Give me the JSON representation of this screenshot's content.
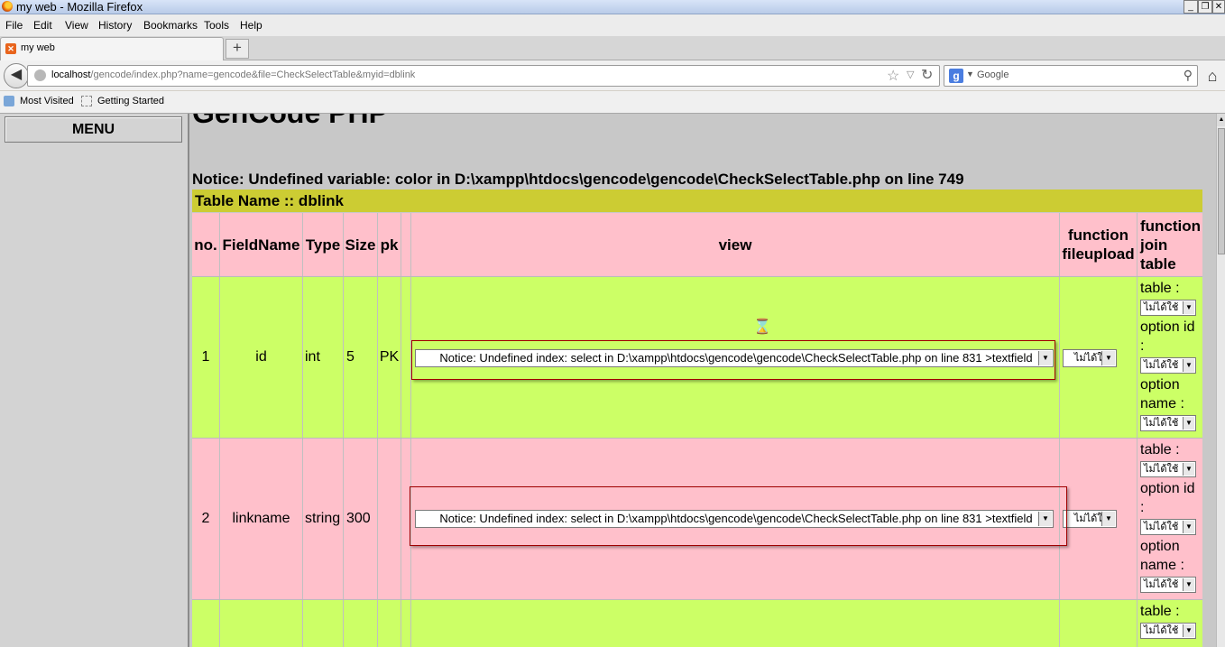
{
  "window": {
    "title": "my web - Mozilla Firefox",
    "min": "_",
    "restore": "❐",
    "close": "✕"
  },
  "menubar": [
    "File",
    "Edit",
    "View",
    "History",
    "Bookmarks",
    "Tools",
    "Help"
  ],
  "tab": {
    "label": "my web",
    "new_tab": "+"
  },
  "address": {
    "host": "localhost",
    "path": "/gencode/index.php?name=gencode&file=CheckSelectTable&myid=dblink"
  },
  "search": {
    "engine_icon": "g-icon",
    "placeholder": "Google"
  },
  "bookmarks": [
    "Most Visited",
    "Getting Started"
  ],
  "left": {
    "menu_label": "MENU"
  },
  "page": {
    "title": "GenCode PHP",
    "notice": "Notice: Undefined variable: color in D:\\xampp\\htdocs\\gencode\\gencode\\CheckSelectTable.php on line 749",
    "table_name": "Table Name :: dblink"
  },
  "table": {
    "headers": {
      "no": "no.",
      "fieldname": "FieldName",
      "type": "Type",
      "size": "Size",
      "pk": "pk",
      "view": "view",
      "fileupload": "function fileupload",
      "join": "function join table"
    },
    "rows": [
      {
        "no": "1",
        "fieldname": "id",
        "type": "int",
        "size": "5",
        "pk": "PK"
      },
      {
        "no": "2",
        "fieldname": "linkname",
        "type": "string",
        "size": "300",
        "pk": ""
      }
    ],
    "view_select_value": "Notice: Undefined index: select in D:\\xampp\\htdocs\\gencode\\gencode\\CheckSelectTable.php on line 831 >textfield",
    "fileupload_select_value": "ไม่ได้ใช้",
    "join": {
      "table_label": "table :",
      "option_id_label": "option id :",
      "option_name_label": "option name :",
      "select_value": "ไม่ได้ใช้"
    }
  },
  "colors": {
    "header_row": "#ffc0cb",
    "odd_row": "#ccff66",
    "table_title": "#cccc33"
  }
}
